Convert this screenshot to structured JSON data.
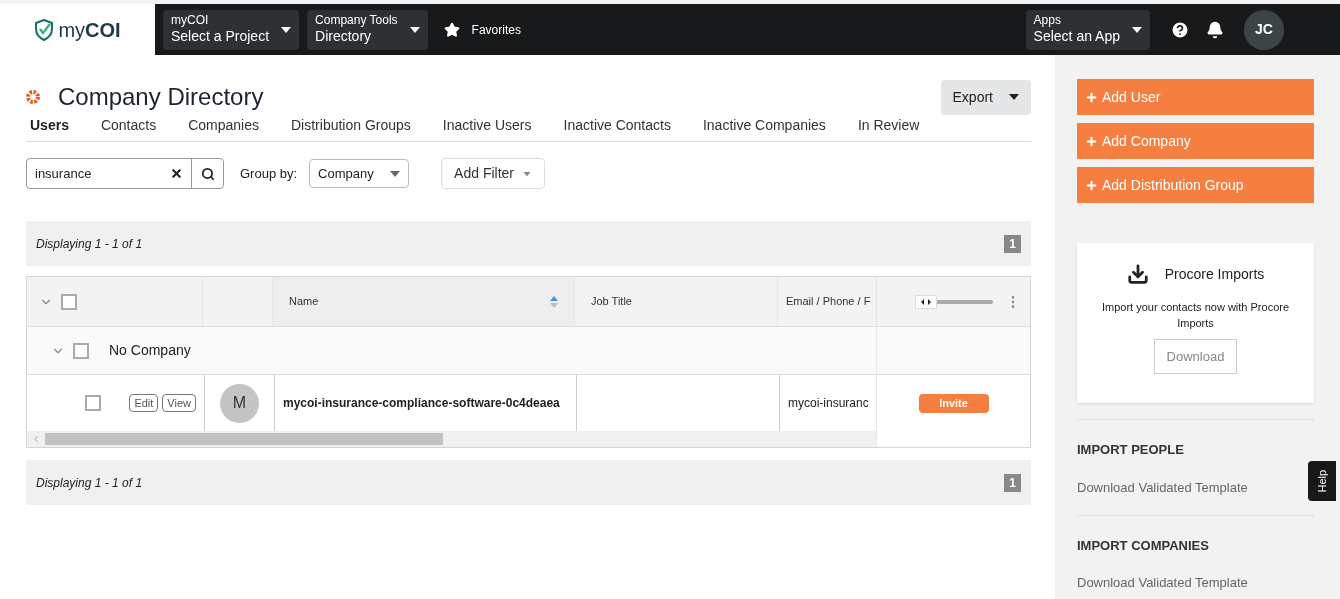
{
  "topbar": {
    "logo": "my**COI**",
    "selectors": [
      {
        "label": "myCOI",
        "value": "Select a Project"
      },
      {
        "label": "Company Tools",
        "value": "Directory"
      }
    ],
    "favorites": "Favorites",
    "apps": {
      "label": "Apps",
      "value": "Select an App"
    },
    "avatar": "JC"
  },
  "page": {
    "title": "Company Directory",
    "export": "Export"
  },
  "tabs": [
    {
      "label": "Users",
      "selected": true
    },
    {
      "label": "Contacts",
      "selected": false
    },
    {
      "label": "Companies",
      "selected": false
    },
    {
      "label": "Distribution Groups",
      "selected": false
    },
    {
      "label": "Inactive Users",
      "selected": false
    },
    {
      "label": "Inactive Contacts",
      "selected": false
    },
    {
      "label": "Inactive Companies",
      "selected": false
    },
    {
      "label": "In Review",
      "selected": false
    }
  ],
  "search": {
    "value": "insurance"
  },
  "group_by": {
    "label": "Group by:",
    "value": "Company"
  },
  "add_filter": "Add Filter",
  "displaying_top": {
    "text": "Displaying 1 - 1 of 1",
    "page": "1"
  },
  "table": {
    "select_all": {
      "checked": false
    },
    "column_slider": {
      "level": 0.0
    },
    "columns": [
      "Name",
      "Job Title",
      "Email / Phone / F"
    ],
    "groups": [
      {
        "name": "No Company",
        "checked": false,
        "rows": [
          {
            "checked": false,
            "edit": "Edit",
            "view": "View",
            "avatar": "M",
            "name": "mycoi-insurance-compliance-software-0c4deaea",
            "email": "mycoi-insuranc",
            "action": "Invite"
          }
        ]
      }
    ]
  },
  "displaying_bottom": {
    "text": "Displaying 1 - 1 of 1",
    "page": "1"
  },
  "sidebar": {
    "buttons": [
      "Add User",
      "Add Company",
      "Add Distribution Group"
    ],
    "procore": {
      "title": "Procore Imports",
      "text": "Import your contacts now with Procore Imports",
      "button": "Download"
    },
    "sections": [
      {
        "heading": "IMPORT PEOPLE",
        "link": "Download Validated Template"
      },
      {
        "heading": "IMPORT COMPANIES",
        "link": "Download Validated Template"
      }
    ]
  },
  "help_tab": "Help"
}
